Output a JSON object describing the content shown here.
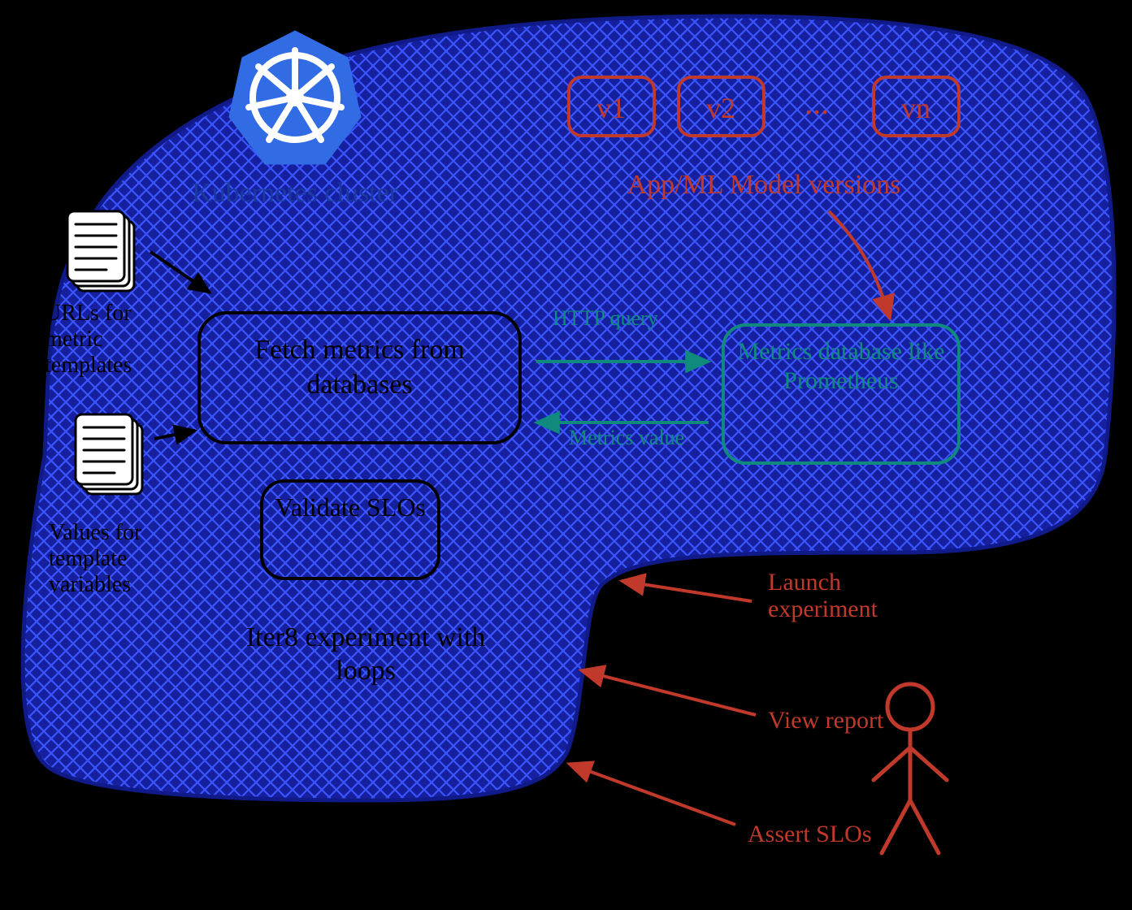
{
  "cluster_label": "Kubernetes cluster",
  "docs": {
    "urls_label": "URLs for metric templates",
    "values_label": "Values for template variables"
  },
  "tasks": {
    "fetch": "Fetch metrics from databases",
    "validate": "Validate SLOs",
    "experiment": "Iter8 experiment with loops"
  },
  "versions": {
    "items": [
      "v1",
      "v2",
      "vn"
    ],
    "ellipsis": "...",
    "label": "App/ML Model versions"
  },
  "metrics_db": {
    "label": "Metrics database like Prometheus",
    "query_label": "HTTP query",
    "value_label": "Metrics value"
  },
  "actions": {
    "launch": "Launch experiment",
    "view": "View report",
    "assert": "Assert SLOs"
  },
  "colors": {
    "blue_dark": "#1b3aa0",
    "blue_hatch": "#2a45d9",
    "k8s": "#326ce5",
    "red": "#c0392b",
    "teal": "#0f8a7d",
    "black": "#000000"
  }
}
